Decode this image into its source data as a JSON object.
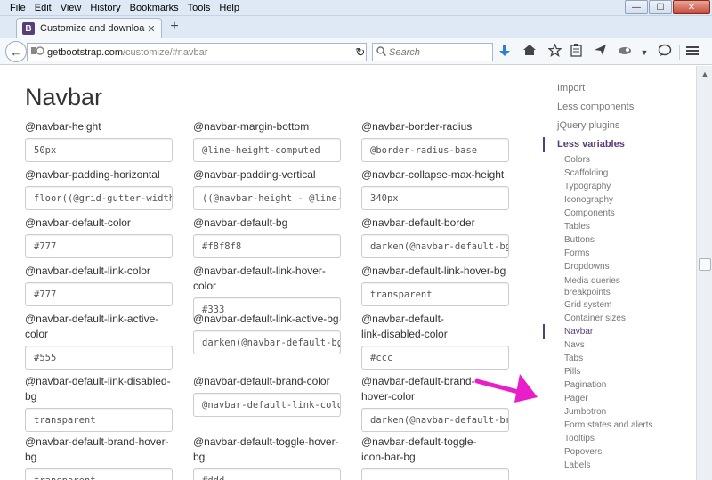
{
  "menubar": {
    "items": [
      {
        "label": "File",
        "u": "F",
        "rest": "ile"
      },
      {
        "label": "Edit",
        "u": "E",
        "rest": "dit"
      },
      {
        "label": "View",
        "u": "V",
        "rest": "iew"
      },
      {
        "label": "History",
        "u": "H",
        "rest": "istory"
      },
      {
        "label": "Bookmarks",
        "u": "B",
        "rest": "ookmarks"
      },
      {
        "label": "Tools",
        "u": "T",
        "rest": "ools"
      },
      {
        "label": "Help",
        "u": "H",
        "rest": "elp"
      }
    ],
    "minimize": "—",
    "maximize": "☐",
    "close": "✕"
  },
  "tab": {
    "favicon": "B",
    "title": "Customize and download -...",
    "close": "✕",
    "new_tab": "+"
  },
  "toolbar": {
    "back": "←",
    "url_host": "getbootstrap.com",
    "url_path": "/customize/#navbar",
    "url_dropdown": "▽",
    "reload": "↻",
    "search_placeholder": "Search",
    "icons": [
      "download-icon",
      "home-icon",
      "star-icon",
      "reading-list-icon",
      "send-icon",
      "extension-icon",
      "dropdown-icon",
      "chat-icon",
      "menu-icon"
    ]
  },
  "page": {
    "heading": "Navbar",
    "columns": [
      [
        {
          "label": "@navbar-height",
          "value": "50px"
        },
        {
          "label": "@navbar-padding-horizontal",
          "value": "floor((@grid-gutter-width"
        },
        {
          "label": "@navbar-default-color",
          "value": "#777"
        },
        {
          "label": "@navbar-default-link-color",
          "value": "#777"
        },
        {
          "label": "@navbar-default-link-active-color",
          "value": "#555"
        },
        {
          "label": "@navbar-default-link-disabled-bg",
          "value": "transparent"
        },
        {
          "label": "@navbar-default-brand-hover-bg",
          "value": "transparent"
        }
      ],
      [
        {
          "label": "@navbar-margin-bottom",
          "value": "@line-height-computed"
        },
        {
          "label": "@navbar-padding-vertical",
          "value": "((@navbar-height - @line-height-computed"
        },
        {
          "label": "@navbar-default-bg",
          "value": "#f8f8f8"
        },
        {
          "label": "@navbar-default-link-hover-color",
          "value": "#333"
        },
        {
          "label": "@navbar-default-link-active-bg",
          "value": "darken(@navbar-default-bg"
        },
        {
          "label": "@navbar-default-brand-color",
          "value": "@navbar-default-link-color"
        },
        {
          "label": "@navbar-default-toggle-hover-bg",
          "value": "#ddd"
        }
      ],
      [
        {
          "label": "@navbar-border-radius",
          "value": "@border-radius-base"
        },
        {
          "label": "@navbar-collapse-max-height",
          "value": "340px"
        },
        {
          "label": "@navbar-default-border",
          "value": "darken(@navbar-default-bg"
        },
        {
          "label": "@navbar-default-link-hover-bg",
          "value": "transparent"
        },
        {
          "label": "@navbar-default-link-disabled-color",
          "label_lines": [
            "@navbar-default-",
            "link-disabled-color"
          ],
          "value": "#ccc"
        },
        {
          "label": "@navbar-default-brand-hover-color",
          "label_lines": [
            "@navbar-default-brand-",
            "hover-color"
          ],
          "value": "darken(@navbar-default-brand"
        },
        {
          "label": "@navbar-default-toggle-icon-bar-bg",
          "label_lines": [
            "@navbar-default-toggle-",
            "icon-bar-bg"
          ],
          "value": ""
        }
      ]
    ]
  },
  "sidenav": {
    "top": [
      "Import",
      "Less components",
      "jQuery plugins",
      "Less variables"
    ],
    "active_top": "Less variables",
    "sub": [
      "Colors",
      "Scaffolding",
      "Typography",
      "Iconography",
      "Components",
      "Tables",
      "Buttons",
      "Forms",
      "Dropdowns",
      "Media queries breakpoints",
      "Grid system",
      "Container sizes",
      "Navbar",
      "Navs",
      "Tabs",
      "Pills",
      "Pagination",
      "Pager",
      "Jumbotron",
      "Form states and alerts",
      "Tooltips",
      "Popovers",
      "Labels"
    ],
    "active_sub": "Navbar"
  },
  "annotation": {
    "arrow_color": "#e81ec8"
  },
  "scrollbar": {
    "up": "▲"
  }
}
